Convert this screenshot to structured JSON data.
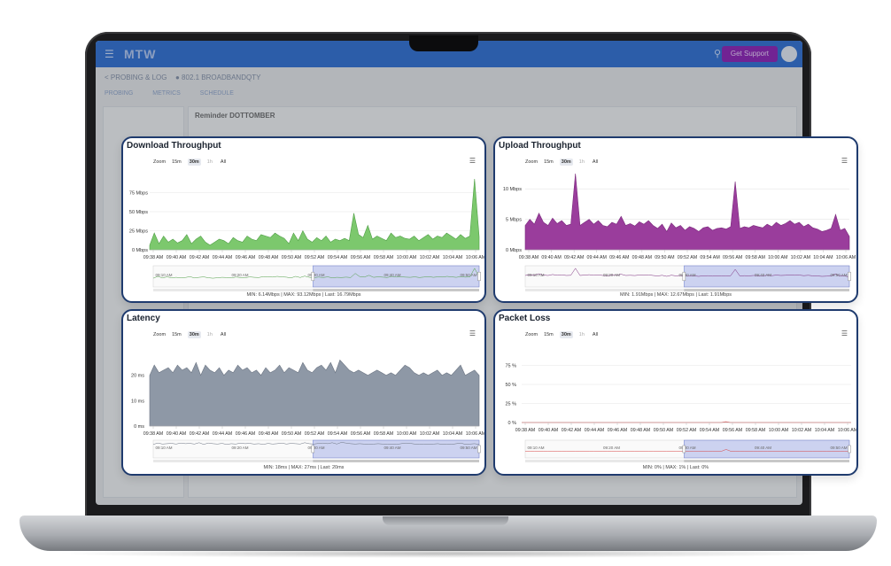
{
  "app": {
    "brand": "MTW",
    "header_button": "Get Support",
    "breadcrumb": "< PROBING & LOG",
    "status_text": "● 802.1 BROADBANDQTY",
    "tabs": [
      "PROBING",
      "METRICS",
      "SCHEDULE"
    ],
    "panel_heading": "Reminder DOTTOMBER"
  },
  "icons": {
    "menu": "menu-icon",
    "search": "search-icon",
    "avatar": "avatar"
  },
  "zoom": {
    "label": "Zoom",
    "options": [
      "15m",
      "30m",
      "1h",
      "All"
    ],
    "selected": "30m",
    "disabled": "1h"
  },
  "charts": {
    "download": {
      "title": "Download Throughput",
      "stats": "MIN: 6.14Mbps | MAX: 93.12Mbps | Last: 16.79Mbps",
      "chart_data": {
        "type": "area",
        "title": "Download Throughput",
        "yticks": [
          "75 Mbps",
          "50 Mbps",
          "25 Mbps",
          "0 Mbps"
        ],
        "ylim": [
          0,
          100
        ],
        "xticks": [
          "09:38 AM",
          "09:40 AM",
          "09:42 AM",
          "09:44 AM",
          "09:46 AM",
          "09:48 AM",
          "09:50 AM",
          "09:52 AM",
          "09:54 AM",
          "09:56 AM",
          "09:58 AM",
          "10:00 AM",
          "10:02 AM",
          "10:04 AM",
          "10:06 AM"
        ],
        "navigator_ticks": [
          "09:10 AM",
          "09:20 AM",
          "09:30 AM",
          "09:40 AM",
          "09:50 AM"
        ],
        "color": "#7cc86d",
        "stroke": "#4f9e45",
        "values": [
          6,
          22,
          8,
          18,
          10,
          14,
          9,
          12,
          20,
          8,
          14,
          18,
          10,
          6,
          10,
          14,
          12,
          8,
          16,
          12,
          10,
          18,
          14,
          12,
          20,
          18,
          16,
          22,
          18,
          15,
          8,
          22,
          12,
          25,
          14,
          10,
          16,
          12,
          18,
          10,
          14,
          12,
          15,
          12,
          48,
          20,
          16,
          32,
          14,
          18,
          15,
          12,
          22,
          16,
          18,
          15,
          14,
          18,
          12,
          16,
          20,
          14,
          18,
          16,
          22,
          18,
          14,
          20,
          15,
          18,
          93,
          17
        ]
      }
    },
    "upload": {
      "title": "Upload Throughput",
      "stats": "MIN: 1.91Mbps | MAX: 12.67Mbps | Last: 1.91Mbps",
      "chart_data": {
        "type": "area",
        "title": "Upload Throughput",
        "yticks": [
          "10 Mbps",
          "5 Mbps",
          "0 Mbps"
        ],
        "ylim": [
          0,
          12.5
        ],
        "xticks": [
          "09:38 AM",
          "09:40 AM",
          "09:42 AM",
          "09:44 AM",
          "09:46 AM",
          "09:48 AM",
          "09:50 AM",
          "09:52 AM",
          "09:54 AM",
          "09:56 AM",
          "09:58 AM",
          "10:00 AM",
          "10:02 AM",
          "10:04 AM",
          "10:06 AM"
        ],
        "navigator_ticks": [
          "09:10 AM",
          "09:20 AM",
          "09:30 AM",
          "09:40 AM",
          "09:50 AM"
        ],
        "color": "#9a3d9c",
        "stroke": "#7a2a7c",
        "values": [
          4,
          5,
          4.2,
          6,
          4.5,
          4,
          5.2,
          4.3,
          4.8,
          4,
          4.2,
          12.5,
          4,
          4.5,
          5,
          4.2,
          4.8,
          4,
          3.8,
          4.5,
          4.2,
          5.5,
          4,
          4.3,
          3.9,
          4.6,
          4.2,
          4.8,
          4,
          3.5,
          4.2,
          3,
          4.4,
          3.6,
          4,
          3.2,
          3.8,
          3.5,
          3,
          3.6,
          3.8,
          3.2,
          3.5,
          3.6,
          3.4,
          3.8,
          11.2,
          3.5,
          3.8,
          3.6,
          4,
          3.8,
          3.6,
          4.2,
          3.8,
          4.5,
          4,
          4.3,
          4.8,
          4.2,
          4.5,
          3.8,
          4.2,
          3.6,
          3.4,
          3,
          3.2,
          3.5,
          5.8,
          3.2,
          3.5,
          2.2
        ]
      }
    },
    "latency": {
      "title": "Latency",
      "stats": "MIN: 18ms | MAX: 27ms | Last: 20ms",
      "chart_data": {
        "type": "area",
        "title": "Latency",
        "yticks": [
          "20 ms",
          "10 ms",
          "0 ms"
        ],
        "ylim": [
          0,
          30
        ],
        "xticks": [
          "09:38 AM",
          "09:40 AM",
          "09:42 AM",
          "09:44 AM",
          "09:46 AM",
          "09:48 AM",
          "09:50 AM",
          "09:52 AM",
          "09:54 AM",
          "09:56 AM",
          "09:58 AM",
          "10:00 AM",
          "10:02 AM",
          "10:04 AM",
          "10:06 AM"
        ],
        "navigator_ticks": [
          "09:10 AM",
          "09:20 AM",
          "09:30 AM",
          "09:40 AM",
          "09:50 AM"
        ],
        "color": "#8e98a6",
        "stroke": "#6b7482",
        "values": [
          20,
          24,
          21,
          22,
          23,
          21,
          24,
          22,
          23,
          21,
          25,
          20,
          24,
          22,
          21,
          23,
          20,
          22,
          21,
          24,
          22,
          23,
          21,
          22,
          20,
          23,
          21,
          22,
          24,
          21,
          23,
          22,
          21,
          25,
          22,
          21,
          23,
          24,
          22,
          25,
          21,
          26,
          24,
          22,
          21,
          22,
          21,
          20,
          21,
          22,
          21,
          20,
          21,
          20,
          22,
          24,
          23,
          21,
          20,
          21,
          20,
          21,
          22,
          20,
          21,
          20,
          22,
          24,
          20,
          21,
          22,
          20
        ]
      }
    },
    "packet_loss": {
      "title": "Packet Loss",
      "stats": "MIN: 0% | MAX: 1% | Last: 0%",
      "chart_data": {
        "type": "line",
        "title": "Packet Loss",
        "yticks": [
          "75 %",
          "50 %",
          "25 %",
          "0 %"
        ],
        "ylim": [
          0,
          100
        ],
        "xticks": [
          "09:38 AM",
          "09:40 AM",
          "09:42 AM",
          "09:44 AM",
          "09:46 AM",
          "09:48 AM",
          "09:50 AM",
          "09:52 AM",
          "09:54 AM",
          "09:56 AM",
          "09:58 AM",
          "10:00 AM",
          "10:02 AM",
          "10:04 AM",
          "10:06 AM"
        ],
        "navigator_ticks": [
          "09:10 AM",
          "09:20 AM",
          "09:30 AM",
          "09:40 AM",
          "09:50 AM"
        ],
        "color": "#e05a5a",
        "stroke": "#d64545",
        "values": [
          0,
          0,
          0,
          0,
          0,
          0,
          0,
          0,
          0,
          0,
          0,
          0,
          0,
          0,
          0,
          0,
          0,
          0,
          0,
          0,
          0,
          0,
          0,
          0,
          0,
          0,
          0,
          0,
          0,
          0,
          0,
          0,
          0,
          0,
          0,
          0,
          0,
          0,
          0,
          0,
          0,
          0,
          0,
          0,
          1,
          0,
          0,
          0,
          0,
          0,
          0,
          0,
          0,
          0,
          0,
          0,
          0,
          0,
          0,
          0,
          0,
          0,
          0,
          0,
          0,
          0,
          0,
          0,
          0,
          0,
          0,
          0
        ]
      }
    }
  }
}
